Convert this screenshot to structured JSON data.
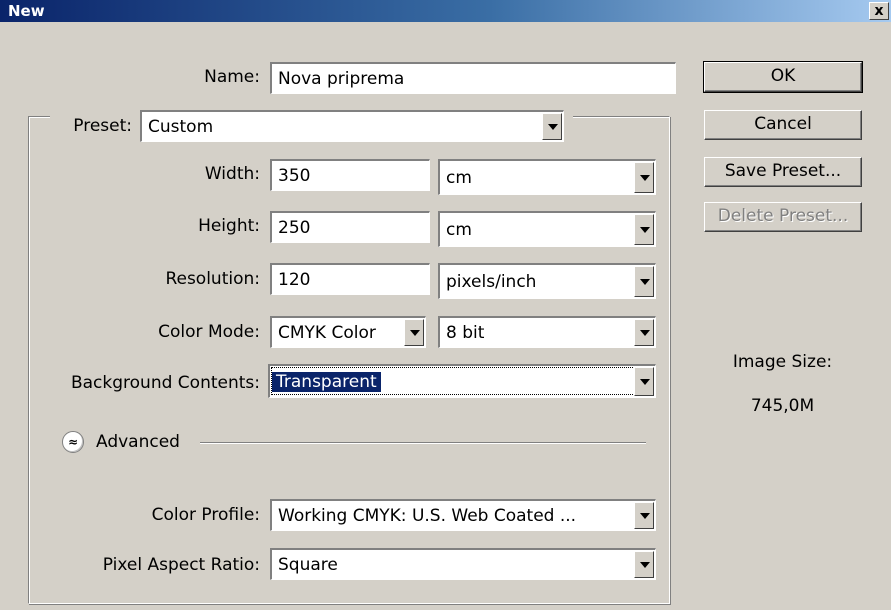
{
  "window": {
    "title": "New",
    "close_glyph": "x"
  },
  "form": {
    "name_label": "Name:",
    "name_value": "Nova priprema",
    "preset_label": "Preset:",
    "preset_value": "Custom",
    "width_label": "Width:",
    "width_value": "350",
    "width_unit": "cm",
    "height_label": "Height:",
    "height_value": "250",
    "height_unit": "cm",
    "resolution_label": "Resolution:",
    "resolution_value": "120",
    "resolution_unit": "pixels/inch",
    "color_mode_label": "Color Mode:",
    "color_mode_value": "CMYK Color",
    "bit_depth_value": "8 bit",
    "background_label": "Background Contents:",
    "background_value": "Transparent",
    "advanced_label": "Advanced",
    "advanced_glyph": "≈",
    "color_profile_label": "Color Profile:",
    "color_profile_value": "Working CMYK:  U.S. Web Coated ...",
    "pixel_aspect_label": "Pixel Aspect Ratio:",
    "pixel_aspect_value": "Square"
  },
  "buttons": {
    "ok": "OK",
    "cancel": "Cancel",
    "save_preset": "Save Preset...",
    "delete_preset": "Delete Preset..."
  },
  "info": {
    "image_size_label": "Image Size:",
    "image_size_value": "745,0M"
  },
  "colors": {
    "titlebar_start": "#0a246a",
    "titlebar_end": "#a6caf0",
    "selection": "#0a246a",
    "dialog_bg": "#d4d0c8"
  }
}
